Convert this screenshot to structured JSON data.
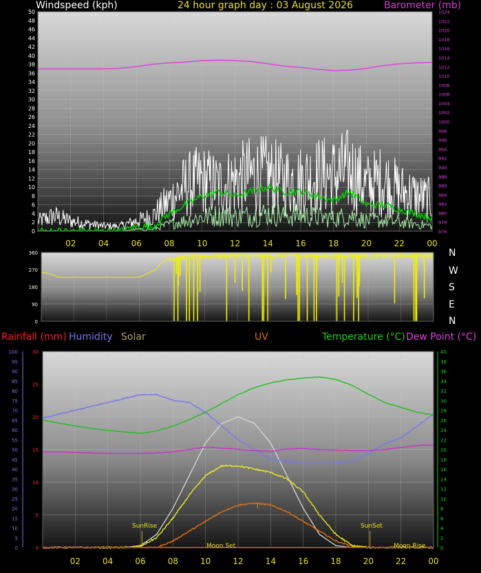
{
  "header": {
    "left": "Windspeed (kph)",
    "center": "24 hour graph day : 03 August 2026",
    "right": "Barometer (mb)"
  },
  "compass": [
    "N",
    "W",
    "S",
    "E",
    "N"
  ],
  "legend2": {
    "rainfall": "Rainfall (mm)",
    "humidity": "Humidity",
    "solar": "Solar",
    "uv": "UV",
    "temperature": "Temperature (°C)",
    "dewpoint": "Dew Point (°C)"
  },
  "annotations": {
    "sunrise": "SunRise",
    "sunset": "SunSet",
    "moonset": "Moon Set",
    "moonrise": "Moon Rise"
  },
  "colors": {
    "wind": "#ffffff",
    "gust_avg": "#00d000",
    "wind_low": "#a8f0a8",
    "barometer": "#e040e0",
    "direction": "#f0f000",
    "rain": "#ff2020",
    "humidity": "#7878f0",
    "solar": "#d8d8d8",
    "solar_meas": "#e8e820",
    "uv": "#e07010",
    "temperature": "#20c020",
    "dewpoint": "#d030d0"
  },
  "chart_data": [
    {
      "type": "line",
      "title": "24 hour graph day : 03 August 2026",
      "xlabel": "",
      "x_ticks": [
        "02",
        "04",
        "06",
        "08",
        "10",
        "12",
        "14",
        "16",
        "18",
        "20",
        "22",
        "00"
      ],
      "ylabel": "Windspeed (kph)",
      "ylim": [
        0,
        50
      ],
      "y_ticks": [
        0,
        2,
        4,
        6,
        8,
        10,
        12,
        14,
        16,
        18,
        20,
        22,
        24,
        26,
        28,
        30,
        32,
        34,
        36,
        38,
        40,
        42,
        44,
        46,
        48,
        50
      ],
      "y2label": "Barometer (mb)",
      "y2lim": [
        976,
        1024
      ],
      "y2_ticks": [
        976,
        978,
        980,
        982,
        984,
        986,
        988,
        990,
        992,
        994,
        996,
        998,
        1000,
        1002,
        1004,
        1006,
        1008,
        1010,
        1012,
        1014,
        1016,
        1018,
        1020,
        1022,
        1024
      ],
      "hours": [
        0,
        1,
        2,
        3,
        4,
        5,
        6,
        7,
        8,
        9,
        10,
        11,
        12,
        13,
        14,
        15,
        16,
        17,
        18,
        19,
        20,
        21,
        22,
        23,
        24
      ],
      "series": [
        {
          "key": "wind_gust_peak",
          "values": [
            4,
            6,
            4,
            3,
            2,
            2,
            4,
            6,
            12,
            18,
            20,
            18,
            20,
            22,
            22,
            20,
            20,
            22,
            22,
            24,
            18,
            20,
            16,
            14,
            12
          ]
        },
        {
          "key": "wind_avg",
          "values": [
            0,
            0,
            0,
            0,
            0,
            0,
            1,
            1,
            4,
            6,
            8,
            9,
            8,
            9,
            10,
            9,
            9,
            8,
            7,
            9,
            6,
            6,
            5,
            4,
            3
          ]
        },
        {
          "key": "barometer",
          "values": [
            1011.5,
            1011.5,
            1011.5,
            1011.5,
            1011.5,
            1011.6,
            1012.0,
            1012.5,
            1012.8,
            1013.0,
            1013.3,
            1013.4,
            1013.3,
            1013.1,
            1012.6,
            1012.1,
            1011.8,
            1011.4,
            1011.1,
            1011.2,
            1011.6,
            1012.2,
            1012.6,
            1012.8,
            1012.9
          ]
        }
      ]
    },
    {
      "type": "line",
      "title": "",
      "x_ticks": [],
      "ylabel": "",
      "ylim": [
        0,
        360
      ],
      "y_ticks": [
        0,
        90,
        180,
        270,
        360
      ],
      "hours": [
        0,
        0.5,
        1.0,
        1.5,
        2,
        3,
        4,
        5,
        6.0,
        6.5,
        7.0,
        7.3,
        7.6,
        8,
        9,
        10,
        11,
        12,
        13,
        14,
        15,
        16,
        17,
        18,
        19,
        20,
        21,
        22,
        23,
        24
      ],
      "series": [
        {
          "key": "wind_direction",
          "values": [
            255,
            250,
            230,
            230,
            230,
            230,
            230,
            230,
            230,
            250,
            270,
            300,
            320,
            330,
            335,
            340,
            340,
            345,
            340,
            340,
            345,
            345,
            340,
            340,
            345,
            340,
            340,
            345,
            345,
            345
          ]
        }
      ]
    },
    {
      "type": "line",
      "title": "",
      "xlabel": "",
      "x_ticks": [
        "02",
        "04",
        "06",
        "08",
        "10",
        "12",
        "14",
        "16",
        "18",
        "20",
        "22",
        "00"
      ],
      "humidity_axis": {
        "range": [
          0,
          100
        ],
        "ticks": [
          0,
          5,
          10,
          15,
          20,
          25,
          30,
          35,
          40,
          45,
          50,
          55,
          60,
          65,
          70,
          75,
          80,
          85,
          90,
          95,
          100
        ]
      },
      "rain_axis": {
        "range": [
          0,
          30
        ],
        "ticks": [
          0,
          5,
          10,
          15,
          20,
          25,
          30
        ]
      },
      "temp_axis": {
        "range": [
          0,
          40
        ],
        "ticks": [
          0,
          2,
          4,
          6,
          8,
          10,
          12,
          14,
          16,
          18,
          20,
          22,
          24,
          26,
          28,
          30,
          32,
          34,
          36,
          38,
          40
        ]
      },
      "hours": [
        0,
        1,
        2,
        3,
        4,
        5,
        6,
        7,
        8,
        9,
        10,
        11,
        12,
        13,
        14,
        15,
        16,
        17,
        18,
        19,
        20,
        21,
        22,
        23,
        24
      ],
      "series": [
        {
          "key": "humidity",
          "values": [
            66,
            68,
            70,
            72,
            74,
            76,
            78,
            78,
            75,
            74,
            69,
            62,
            55,
            50,
            45,
            44,
            43,
            43,
            43,
            44,
            48,
            53,
            56,
            62,
            68
          ]
        },
        {
          "key": "temperature",
          "values": [
            26,
            25.4,
            24.8,
            24.3,
            23.9,
            23.6,
            23.3,
            23.8,
            24.8,
            26.1,
            27.6,
            29.4,
            31.2,
            32.6,
            33.6,
            34.2,
            34.6,
            34.8,
            34.3,
            33.1,
            31.3,
            29.6,
            28.6,
            27.6,
            27
          ]
        },
        {
          "key": "dewpoint",
          "values": [
            19.5,
            19.5,
            19.4,
            19.3,
            19.2,
            19.2,
            19.2,
            19.3,
            19.5,
            20.0,
            20.5,
            20.3,
            20.0,
            19.8,
            19.6,
            20.1,
            20.2,
            20.0,
            19.9,
            19.8,
            19.8,
            20.0,
            20.4,
            20.8,
            21.0
          ]
        },
        {
          "key": "solar_max",
          "values": [
            0,
            0,
            0,
            0,
            0,
            0,
            0.3,
            2.0,
            6.0,
            11.0,
            16.0,
            19.0,
            20.0,
            19.0,
            16.0,
            11.0,
            6.0,
            2.0,
            0.3,
            0,
            0,
            0,
            0,
            0,
            0
          ]
        },
        {
          "key": "solar",
          "values": [
            0,
            0,
            0,
            0,
            0,
            0,
            0.2,
            1.5,
            4.5,
            8.0,
            11.0,
            12.5,
            12.5,
            12.0,
            11.5,
            10.5,
            8.5,
            5.0,
            2.0,
            0.3,
            0,
            0,
            0,
            0,
            0
          ]
        },
        {
          "key": "uv",
          "values": [
            0,
            0,
            0,
            0,
            0,
            0,
            0,
            0,
            1.0,
            2.5,
            4.0,
            5.5,
            6.5,
            6.8,
            6.5,
            5.5,
            4.0,
            2.5,
            1.0,
            0.2,
            0,
            0,
            0,
            0,
            0
          ]
        },
        {
          "key": "rainfall",
          "values": [
            0,
            0,
            0,
            0,
            0,
            0,
            0,
            0,
            0,
            0,
            0,
            0,
            0,
            0,
            0,
            0,
            0,
            0,
            0,
            0,
            0,
            0,
            0,
            0,
            0
          ]
        }
      ]
    }
  ]
}
